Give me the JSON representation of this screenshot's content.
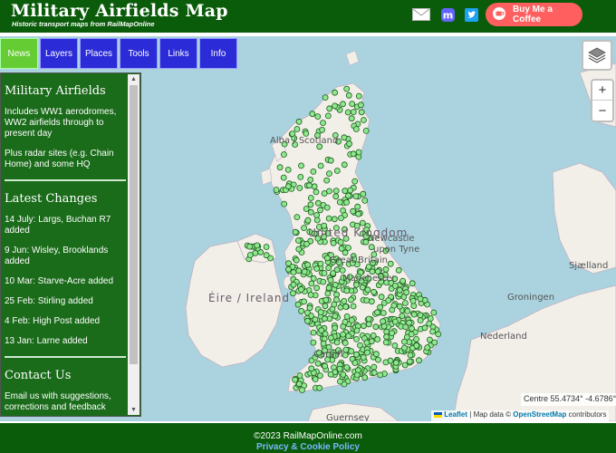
{
  "header": {
    "title": "Military Airfields Map",
    "subtitle": "Historic transport maps from RailMapOnline",
    "coffee_label": "Buy Me a Coffee"
  },
  "nav": [
    {
      "label": "News",
      "active": true
    },
    {
      "label": "Layers"
    },
    {
      "label": "Places"
    },
    {
      "label": "Tools"
    },
    {
      "label": "Links"
    },
    {
      "label": "Info"
    }
  ],
  "sidebar": {
    "heading1": "Military Airfields",
    "intro1": "Includes WW1 aerodromes, WW2 airfields through to present day",
    "intro2": "Plus radar sites (e.g. Chain Home) and some HQ",
    "heading2": "Latest Changes",
    "changes": [
      "14 July: Largs, Buchan R7 added",
      "9 Jun: Wisley, Brooklands added",
      "10 Mar: Starve-Acre added",
      "25 Feb: Stirling added",
      "4 Feb: High Post added",
      "13 Jan: Larne added"
    ],
    "heading3": "Contact Us",
    "contact": "Email us with suggestions, corrections and feedback"
  },
  "map": {
    "labels": {
      "alba": "Alba / Scotland",
      "uk": "United Kingdom",
      "newcastle": "Newcastle",
      "tyne": "upon Tyne",
      "manchester": "Manchester",
      "ireland": "Éire / Ireland",
      "nederland": "Nederland",
      "groningen": "Groningen",
      "sjaelland": "Sjælland",
      "great_britain": "Great Britain",
      "guernsey": "Guernsey",
      "cardiff": "Cardiff"
    },
    "centre_readout": "Centre 55.4734° -4.6786°",
    "attribution_leaflet": "Leaflet",
    "attribution_data": "| Map data ©",
    "attribution_osm": "OpenStreetMap",
    "attribution_contrib": "contributors",
    "colors": {
      "sea": "#aad3df",
      "land": "#f2efe9",
      "marker": "#8fe88f"
    }
  },
  "zoom": {
    "in": "+",
    "out": "−"
  },
  "footer": {
    "copyright": "©2023 RailMapOnline.com",
    "privacy": "Privacy & Cookie Policy"
  }
}
